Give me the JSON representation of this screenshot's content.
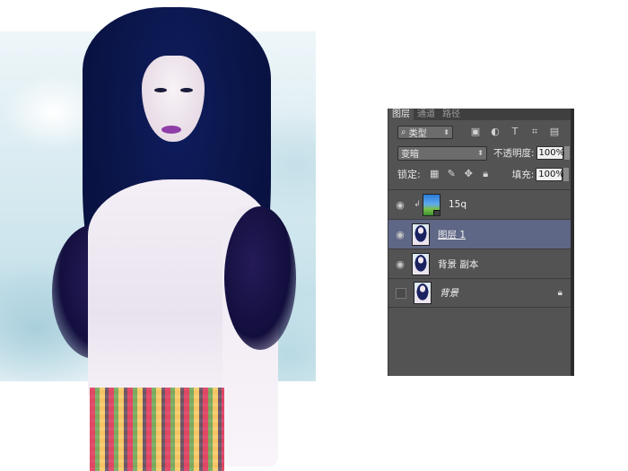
{
  "panel": {
    "tabs": [
      {
        "label": "图层",
        "active": true
      },
      {
        "label": "通道",
        "active": false
      },
      {
        "label": "路径",
        "active": false
      }
    ],
    "filter": {
      "icon": "search-icon",
      "label": "类型",
      "icons": [
        "image-filter-icon",
        "adjustment-filter-icon",
        "type-filter-icon",
        "shape-filter-icon",
        "smartobject-filter-icon"
      ]
    },
    "blend_mode": "变暗",
    "opacity_label": "不透明度:",
    "opacity_value": "100%",
    "lock_label": "锁定:",
    "lock_icons": [
      "lock-transparent-icon",
      "lock-paint-icon",
      "lock-move-icon",
      "lock-all-icon"
    ],
    "fill_label": "填充:",
    "fill_value": "100%",
    "layers": [
      {
        "name": "15q",
        "visible": true,
        "clipped": true,
        "selected": false,
        "thumb": "sky"
      },
      {
        "name": "图层 1",
        "visible": true,
        "clipped": false,
        "selected": true,
        "thumb": "girl"
      },
      {
        "name": "背景 副本",
        "visible": true,
        "clipped": false,
        "selected": false,
        "thumb": "girl"
      },
      {
        "name": "背景",
        "visible": false,
        "clipped": false,
        "selected": false,
        "thumb": "girl",
        "locked": true
      }
    ]
  },
  "colors": {
    "panel_bg": "#535353",
    "selected_layer": "#5f6786",
    "tab_bar": "#3f3f3f"
  }
}
